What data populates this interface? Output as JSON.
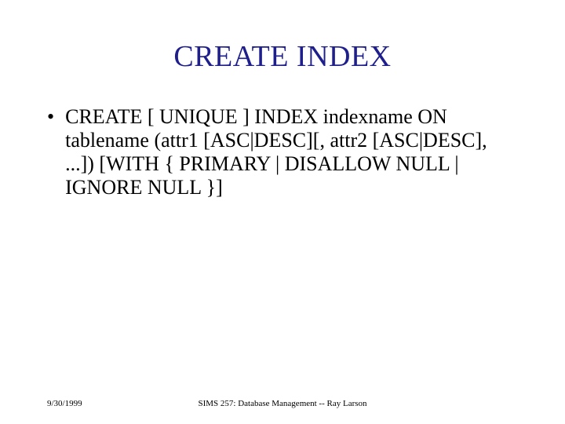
{
  "slide": {
    "title": "CREATE INDEX",
    "bullet_marker": "•",
    "body_text": "CREATE [ UNIQUE ] INDEX indexname ON tablename (attr1 [ASC|DESC][, attr2 [ASC|DESC], ...]) [WITH { PRIMARY | DISALLOW NULL | IGNORE NULL }]"
  },
  "footer": {
    "date": "9/30/1999",
    "course": "SIMS 257: Database Management -- Ray Larson"
  }
}
